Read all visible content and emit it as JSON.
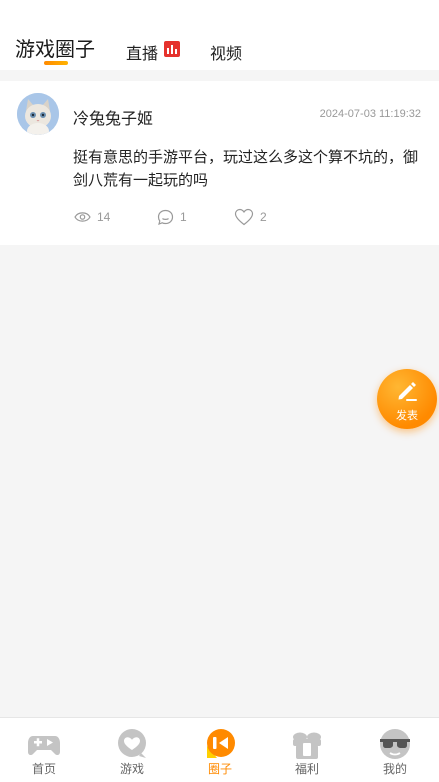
{
  "header": {
    "tabs": [
      {
        "label": "游戏圈子",
        "active": true
      },
      {
        "label": "直播",
        "icon": "live-bars-icon"
      },
      {
        "label": "视频"
      }
    ]
  },
  "post": {
    "username": "冷兔兔子姬",
    "timestamp": "2024-07-03 11:19:32",
    "content": "挺有意思的手游平台，玩过这么多这个算不坑的，御剑八荒有一起玩的吗",
    "views": "14",
    "comments": "1",
    "likes": "2"
  },
  "fab": {
    "label": "发表",
    "icon": "pencil-icon"
  },
  "bottom_nav": [
    {
      "label": "首页",
      "icon": "gamepad-icon"
    },
    {
      "label": "游戏",
      "icon": "heart-bubble-icon"
    },
    {
      "label": "圈子",
      "icon": "circle-play-icon",
      "active": true
    },
    {
      "label": "福利",
      "icon": "gift-icon"
    },
    {
      "label": "我的",
      "icon": "sunglasses-face-icon"
    }
  ],
  "colors": {
    "accent": "#ff8a00",
    "live_red": "#e5322d",
    "nav_inactive_icon": "#c4c4c4",
    "muted_text": "#999999"
  }
}
